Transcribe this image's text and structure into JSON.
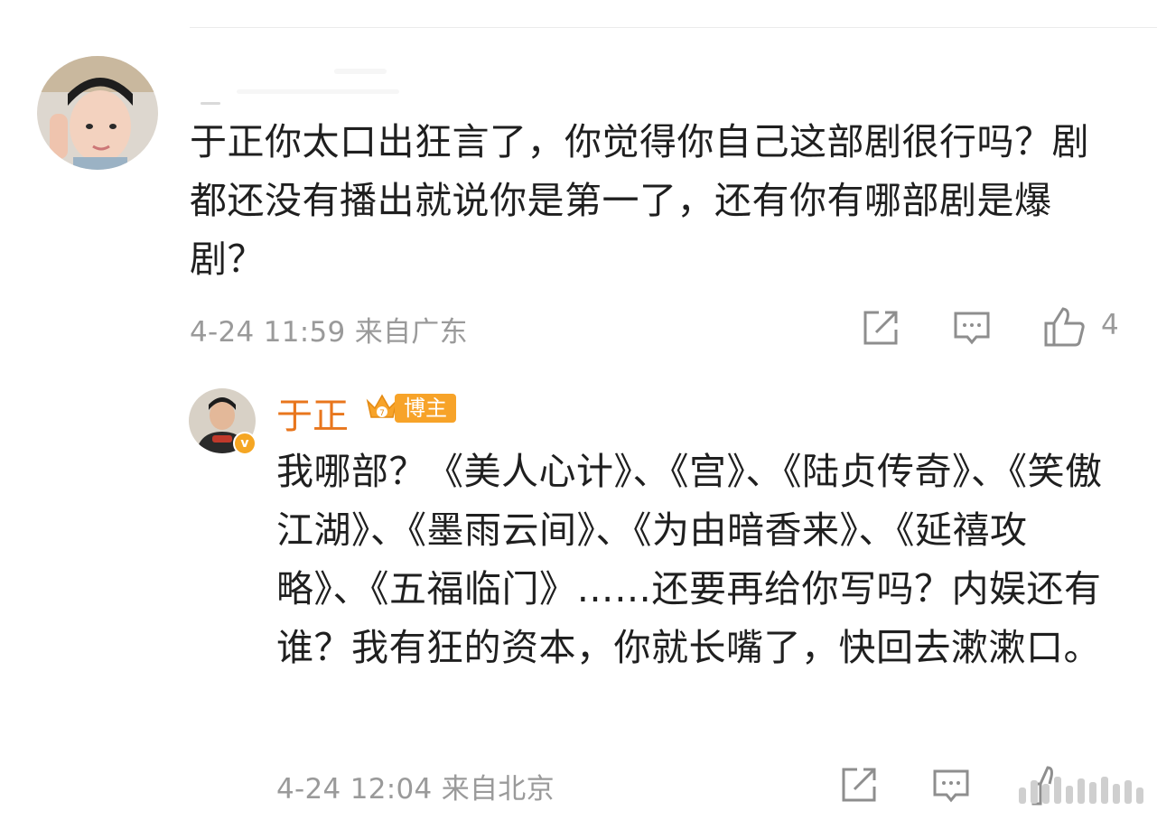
{
  "comment": {
    "text": "于正你太口出狂言了，你觉得你自己这部剧很行吗？剧都还没有播出就说你是第一了，还有你有哪部剧是爆剧？",
    "timestamp": "4-24 11:59",
    "location": "来自广东",
    "like_count": "4",
    "icons": [
      "share-icon",
      "comment-icon",
      "like-icon"
    ]
  },
  "reply": {
    "author": "于正",
    "badge_label": "博主",
    "text": "我哪部？《美人心计》、《宫》、《陆贞传奇》、《笑傲江湖》、《墨雨云间》、《为由暗香来》、《延禧攻略》、《五福临门》……还要再给你写吗？内娱还有谁？我有狂的资本，你就长嘴了，快回去漱漱口。",
    "timestamp": "4-24 12:04",
    "location": "来自北京",
    "icons": [
      "share-icon",
      "comment-icon",
      "like-icon"
    ]
  },
  "colors": {
    "accent_orange": "#e8761d",
    "badge_orange": "#f7a329",
    "meta_gray": "#9a9a9a"
  }
}
